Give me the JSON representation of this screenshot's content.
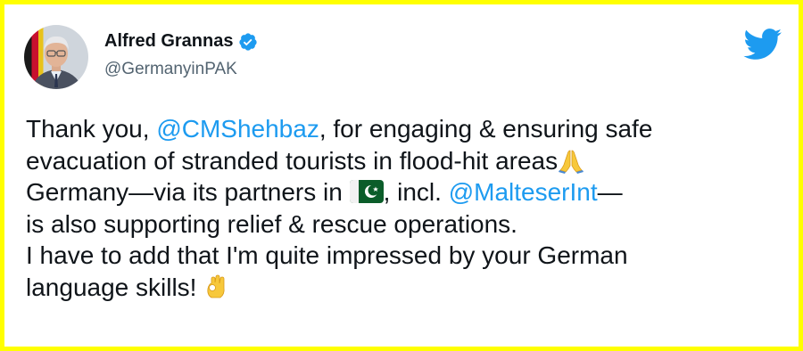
{
  "author": {
    "name": "Alfred Grannas",
    "handle": "@GermanyinPAK",
    "verified": true
  },
  "tweet": {
    "line1_prefix": "Thank you, ",
    "line1_mention": "@CMShehbaz",
    "line1_suffix": ", for engaging & ensuring safe",
    "line2": "evacuation of stranded tourists in flood-hit areas",
    "line2_emoji": "folded-hands-icon",
    "line3_prefix": "Germany—via its partners in ",
    "line3_flag": "pakistan-flag-icon",
    "line3_middle": ", incl. ",
    "line3_mention": "@MalteserInt",
    "line3_suffix": "—",
    "line4": "is also supporting relief & rescue operations.",
    "line5": "I have to add that I'm quite impressed by your German",
    "line6": "language skills! ",
    "line6_emoji": "ok-hand-icon"
  },
  "colors": {
    "frame_border": "#ffff00",
    "mention": "#1d9bf0",
    "text": "#0f1419",
    "handle": "#536471",
    "twitter_blue": "#1d9bf0"
  },
  "icons": [
    "verified-badge-icon",
    "twitter-bird-icon"
  ]
}
